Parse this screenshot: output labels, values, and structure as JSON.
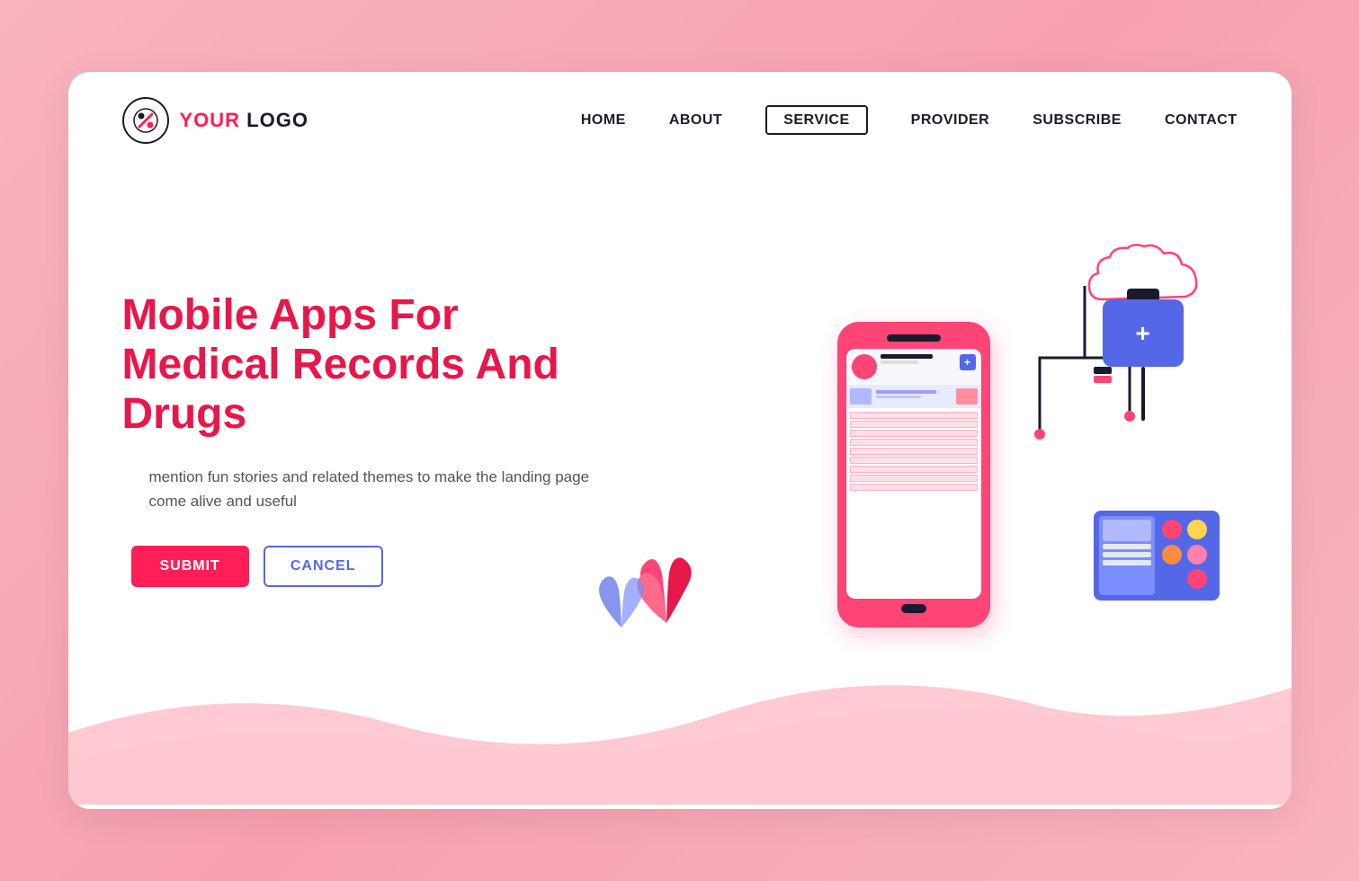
{
  "page": {
    "background_color": "#f9b4c0"
  },
  "logo": {
    "text_your": "YOUR",
    "text_logo": " LOGO"
  },
  "nav": {
    "items": [
      {
        "label": "HOME",
        "active": false
      },
      {
        "label": "ABOUT",
        "active": false
      },
      {
        "label": "SERVICE",
        "active": true
      },
      {
        "label": "PROVIDER",
        "active": false
      },
      {
        "label": "SUBSCRIBE",
        "active": false
      },
      {
        "label": "CONTACT",
        "active": false
      }
    ]
  },
  "hero": {
    "title_line1": "Mobile Apps For",
    "title_line2": "Medical Records And Drugs",
    "description": "mention fun stories and related themes to make\nthe landing page come alive and useful",
    "submit_label": "SUBMIT",
    "cancel_label": "CANCEL"
  },
  "colors": {
    "primary": "#e8174a",
    "accent": "#5468e7",
    "dark": "#1a1a2e"
  }
}
